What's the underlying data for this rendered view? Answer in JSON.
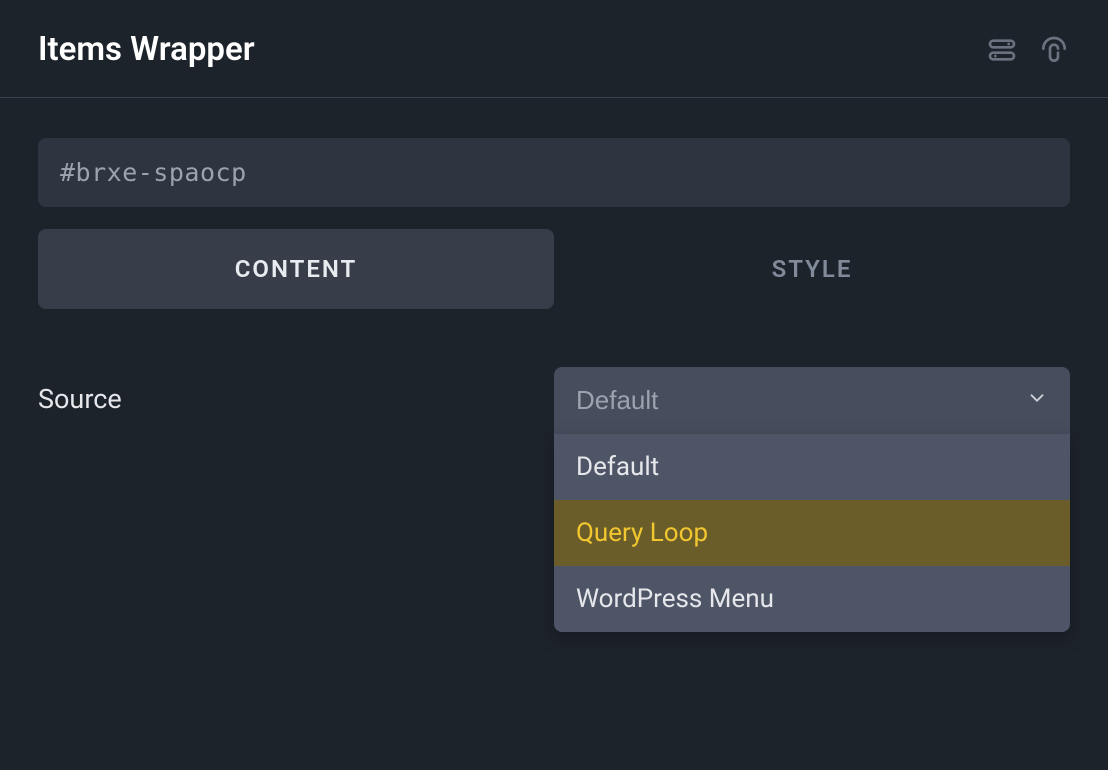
{
  "header": {
    "title": "Items Wrapper"
  },
  "idField": {
    "value": "#brxe-spaocp"
  },
  "tabs": {
    "content": "CONTENT",
    "style": "STYLE"
  },
  "source": {
    "label": "Source",
    "selected": "Default",
    "options": [
      {
        "label": "Default",
        "highlight": false
      },
      {
        "label": "Query Loop",
        "highlight": true
      },
      {
        "label": "WordPress Menu",
        "highlight": false
      }
    ]
  }
}
